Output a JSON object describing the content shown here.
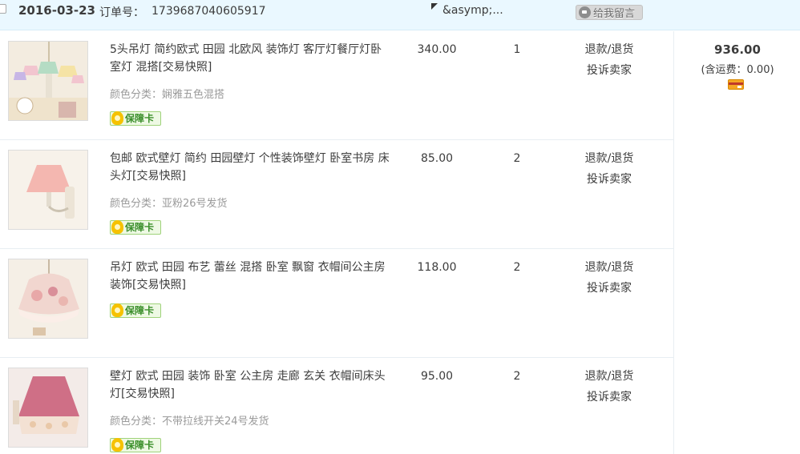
{
  "header": {
    "date": "2016-03-23",
    "order_label": "订单号：",
    "order_no": "1739687040605917",
    "seller": "&asymp;...",
    "message_button": "给我留言"
  },
  "items": [
    {
      "title": "5头吊灯 简约欧式 田园 北欧风 装饰灯 客厅灯餐厅灯卧室灯 混搭[交易快照]",
      "sku": "颜色分类：娴雅五色混搭",
      "guarantee": "保障卡",
      "price": "340.00",
      "qty": "1",
      "action1": "退款/退货",
      "action2": "投诉卖家"
    },
    {
      "title": "包邮 欧式壁灯 简约 田园壁灯 个性装饰壁灯 卧室书房 床头灯[交易快照]",
      "sku": "颜色分类：亚粉26号发货",
      "guarantee": "保障卡",
      "price": "85.00",
      "qty": "2",
      "action1": "退款/退货",
      "action2": "投诉卖家"
    },
    {
      "title": "吊灯 欧式 田园 布艺 蕾丝 混搭 卧室 飘窗 衣帽间公主房 装饰[交易快照]",
      "sku": "",
      "guarantee": "保障卡",
      "price": "118.00",
      "qty": "2",
      "action1": "退款/退货",
      "action2": "投诉卖家"
    },
    {
      "title": "壁灯 欧式 田园 装饰 卧室 公主房 走廊 玄关 衣帽间床头灯[交易快照]",
      "sku": "颜色分类：不带拉线开关24号发货",
      "guarantee": "保障卡",
      "price": "95.00",
      "qty": "2",
      "action1": "退款/退货",
      "action2": "投诉卖家"
    }
  ],
  "total": {
    "amount": "936.00",
    "shipping": "(含运费：0.00)"
  }
}
